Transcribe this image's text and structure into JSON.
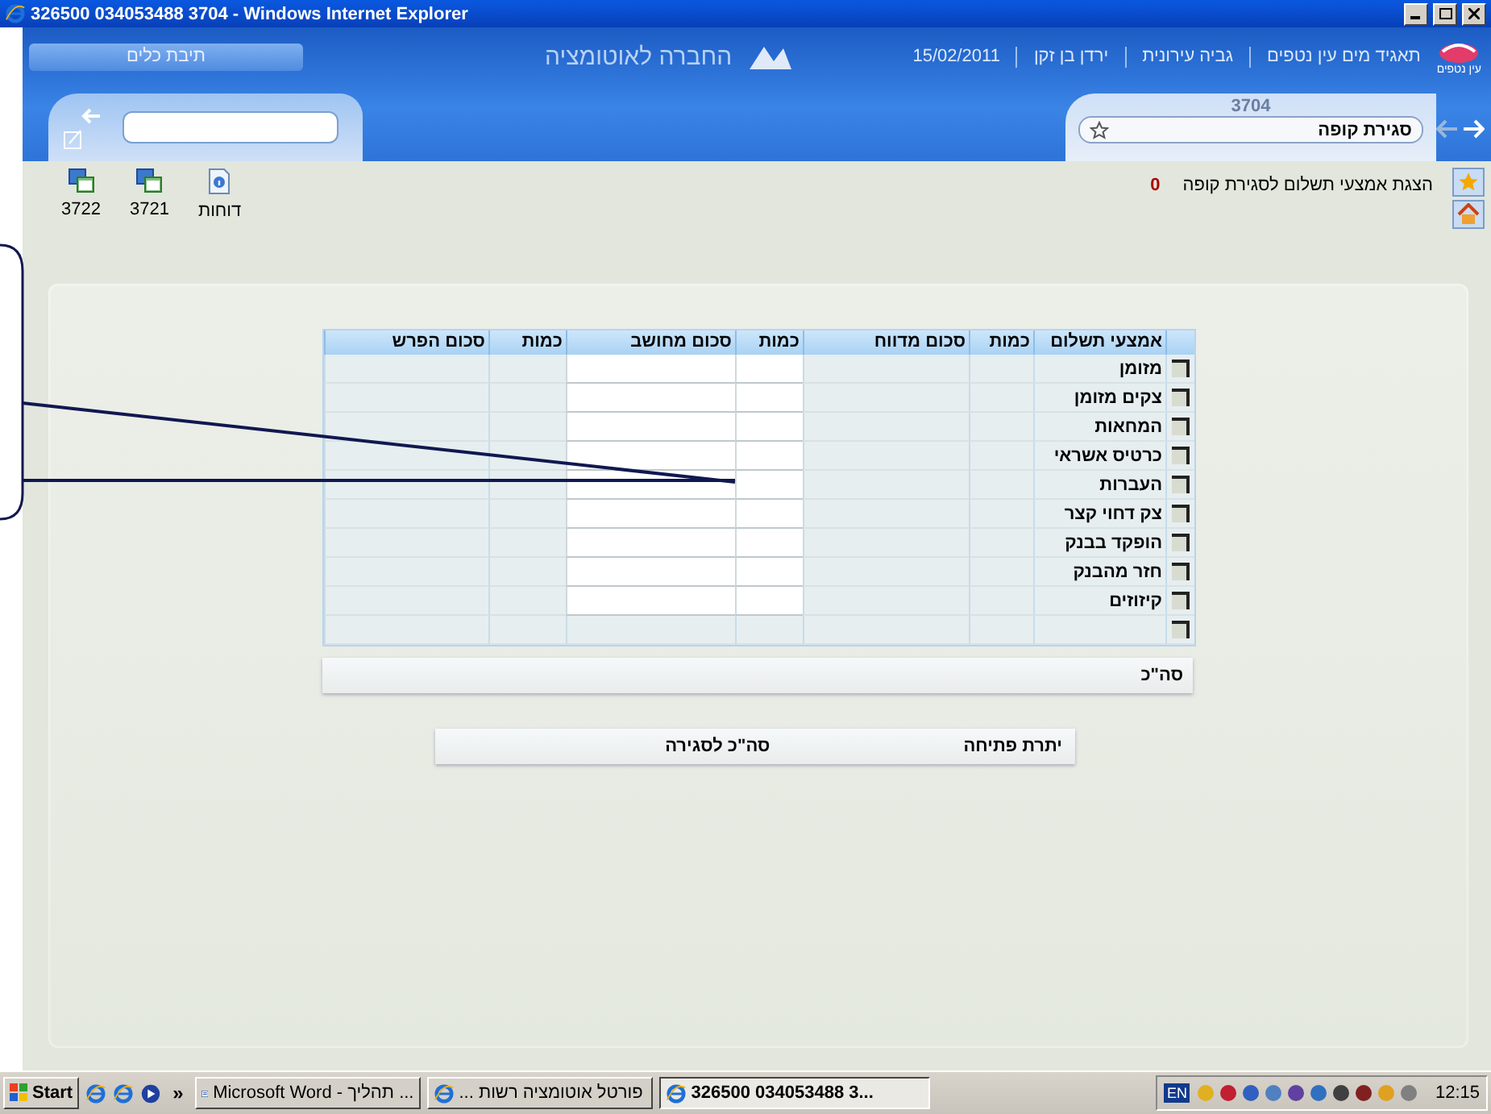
{
  "window": {
    "title": "326500 034053488 3704 - Windows Internet Explorer"
  },
  "header": {
    "toolbox_tab": "תיבת כלים",
    "company": "החברה לאוטומציה",
    "date": "15/02/2011",
    "user": "ירדן בן זקן",
    "department": "גביה עירונית",
    "org": "תאגיד מים עין נטפים",
    "logo_caption": "עין נטפים"
  },
  "page": {
    "code": "3704",
    "title": "סגירת קופה"
  },
  "toolbar": [
    {
      "label": "דוחות",
      "kind": "info"
    },
    {
      "label": "3721",
      "kind": "window"
    },
    {
      "label": "3722",
      "kind": "window"
    }
  ],
  "notice": {
    "text": "הצגת אמצעי תשלום לסגירת קופה",
    "count": "0"
  },
  "table": {
    "columns": [
      "אמצעי תשלום",
      "כמות",
      "סכום מדווח",
      "כמות",
      "סכום מחושב",
      "כמות",
      "סכום הפרש"
    ],
    "rows": [
      {
        "label": "מזומן",
        "checked": false
      },
      {
        "label": "צקים מזומן",
        "checked": false
      },
      {
        "label": "המחאות",
        "checked": false
      },
      {
        "label": "כרטיס אשראי",
        "checked": false
      },
      {
        "label": "העברות",
        "checked": false
      },
      {
        "label": "צק דחוי קצר",
        "checked": false
      },
      {
        "label": "הופקד בבנק",
        "checked": false
      },
      {
        "label": "חזר מהבנק",
        "checked": false
      },
      {
        "label": "קיזוזים",
        "checked": false
      },
      {
        "checked": false
      }
    ]
  },
  "total_label": "סה\"כ",
  "summary": {
    "opening": "יתרת פתיחה",
    "closing": "סה\"כ לסגירה"
  },
  "taskbar": {
    "start": "Start",
    "overflow": "»",
    "word_task": {
      "label": "Microsoft Word - תהליך ...",
      "kind": "word",
      "selected": false
    },
    "portal_task": {
      "label": "פורטל אוטומציה רשות ...",
      "kind": "ie",
      "selected": false
    },
    "browser_task": {
      "label": "326500 034053488 3...",
      "kind": "ie",
      "selected": true
    },
    "language": "EN",
    "clock": "12:15"
  }
}
